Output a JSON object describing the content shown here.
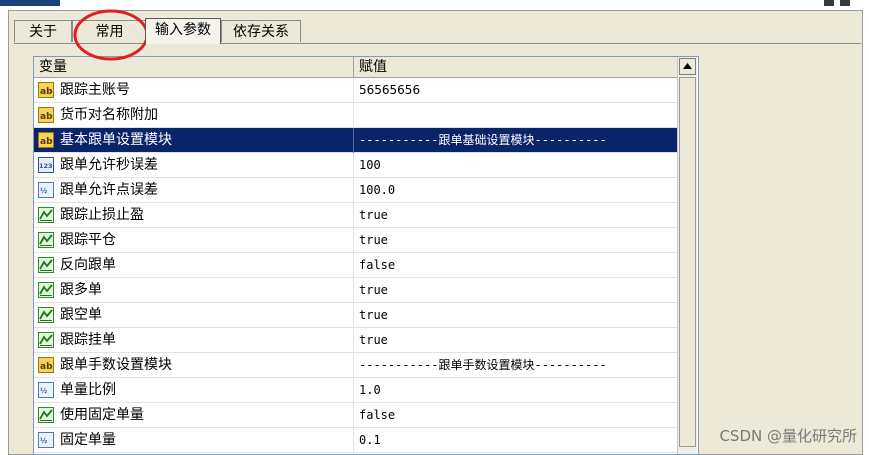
{
  "tabs": [
    {
      "label": "关于"
    },
    {
      "label": "常用"
    },
    {
      "label": "输入参数"
    },
    {
      "label": "依存关系"
    }
  ],
  "table": {
    "headers": [
      "变量",
      "赋值"
    ],
    "rows": [
      {
        "icon": "text-ab-icon",
        "name": "跟踪主账号",
        "value": "56565656"
      },
      {
        "icon": "text-ab-icon",
        "name": "货币对名称附加",
        "value": ""
      },
      {
        "icon": "text-ab-icon",
        "name": "基本跟单设置模块",
        "value": "-----------跟单基础设置模块----------",
        "selected": true
      },
      {
        "icon": "integer-123-icon",
        "name": "跟单允许秒误差",
        "value": "100"
      },
      {
        "icon": "double-v2-icon",
        "name": "跟单允许点误差",
        "value": "100.0"
      },
      {
        "icon": "bool-chart-icon",
        "name": "跟踪止损止盈",
        "value": "true"
      },
      {
        "icon": "bool-chart-icon",
        "name": "跟踪平仓",
        "value": "true"
      },
      {
        "icon": "bool-chart-icon",
        "name": "反向跟单",
        "value": "false"
      },
      {
        "icon": "bool-chart-icon",
        "name": "跟多单",
        "value": "true"
      },
      {
        "icon": "bool-chart-icon",
        "name": "跟空单",
        "value": "true"
      },
      {
        "icon": "bool-chart-icon",
        "name": "跟踪挂单",
        "value": "true"
      },
      {
        "icon": "text-ab-icon",
        "name": "跟单手数设置模块",
        "value": "-----------跟单手数设置模块----------"
      },
      {
        "icon": "double-v2-icon",
        "name": "单量比例",
        "value": "1.0"
      },
      {
        "icon": "bool-chart-icon",
        "name": "使用固定单量",
        "value": "false"
      },
      {
        "icon": "double-v2-icon",
        "name": "固定单量",
        "value": "0.1"
      }
    ]
  },
  "watermark": "CSDN @量化研究所",
  "colors": {
    "selection": "#0a246a",
    "annotation_circle": "#e02020",
    "panel": "#ece9d8"
  }
}
